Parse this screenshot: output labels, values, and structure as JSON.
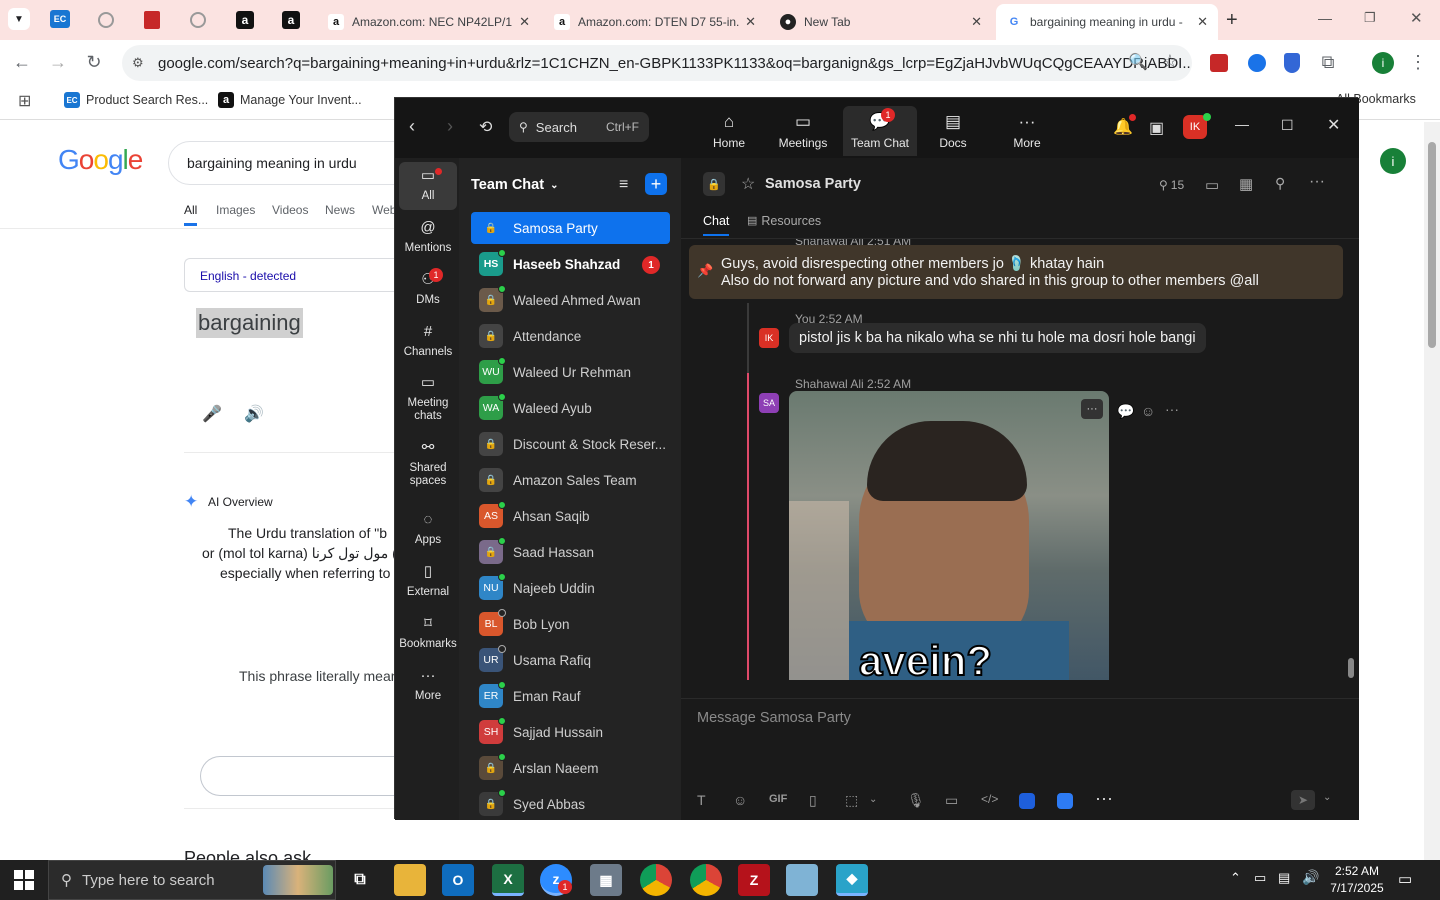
{
  "browser": {
    "tabs": [
      {
        "title": "Amazon.com: NEC NP42LP/1...",
        "icon": "amazon-icon"
      },
      {
        "title": "Amazon.com: DTEN D7 55-in...",
        "icon": "amazon-icon"
      },
      {
        "title": "New Tab",
        "icon": "github-icon"
      },
      {
        "title": "bargaining meaning in urdu -",
        "icon": "google-icon"
      }
    ],
    "url": "google.com/search?q=bargaining+meaning+in+urdu&rlz=1C1CHZN_en-GBPK1133PK1133&oq=barganign&gs_lcrp=EgZjaHJvbWUqCQgCEAAYDRiABDI...",
    "bookmarks": [
      {
        "label": "Product Search Res..."
      },
      {
        "label": "Manage Your Invent..."
      }
    ],
    "all_bookmarks": "All Bookmarks"
  },
  "google": {
    "logo": "Google",
    "query": "bargaining meaning in urdu",
    "nav": [
      "All",
      "Images",
      "Videos",
      "News",
      "Web"
    ],
    "lang_label": "English - detected",
    "source_word": "bargaining",
    "ai_overview": "AI Overview",
    "ai_line1": "The Urdu translation of \"b",
    "ai_line2": "or (mol tol karna) مول تول کرنا (s",
    "ai_line3": "especially when referring to",
    "phrase_line": "This phrase literally means",
    "paa": "People also ask"
  },
  "zoom": {
    "search_label": "Search",
    "search_shortcut": "Ctrl+F",
    "nav": [
      {
        "label": "Home",
        "icon": "home-icon"
      },
      {
        "label": "Meetings",
        "icon": "video-icon"
      },
      {
        "label": "Team Chat",
        "icon": "chat-icon",
        "badge": "1"
      },
      {
        "label": "Docs",
        "icon": "docs-icon"
      },
      {
        "label": "More",
        "icon": "more-icon"
      }
    ],
    "avatar": "IK",
    "rail": [
      {
        "label": "All"
      },
      {
        "label": "Mentions"
      },
      {
        "label": "DMs",
        "badge": "1"
      },
      {
        "label": "Channels"
      },
      {
        "label": "Meeting chats"
      },
      {
        "label": "Shared spaces"
      },
      {
        "label": "Apps"
      },
      {
        "label": "External"
      },
      {
        "label": "Bookmarks"
      },
      {
        "label": "More"
      }
    ],
    "list_header": "Team Chat",
    "chats": [
      {
        "name": "Samosa Party",
        "initials": "",
        "color": "#0e72ed"
      },
      {
        "name": "Haseeb Shahzad",
        "initials": "HS",
        "color": "#1a9c8c",
        "unread": "1"
      },
      {
        "name": "Waleed Ahmed Awan",
        "initials": "",
        "color": "#6b5a4a"
      },
      {
        "name": "Attendance",
        "initials": "",
        "color": "#444444"
      },
      {
        "name": "Waleed Ur Rehman",
        "initials": "WU",
        "color": "#2e9e48"
      },
      {
        "name": "Waleed Ayub",
        "initials": "WA",
        "color": "#2e9e48"
      },
      {
        "name": "Discount & Stock Reser...",
        "initials": "",
        "color": "#444444"
      },
      {
        "name": "Amazon Sales Team",
        "initials": "",
        "color": "#444444"
      },
      {
        "name": "Ahsan Saqib",
        "initials": "AS",
        "color": "#d9572c"
      },
      {
        "name": "Saad Hassan",
        "initials": "",
        "color": "#7a6a8a"
      },
      {
        "name": "Najeeb Uddin",
        "initials": "NU",
        "color": "#2f86c7"
      },
      {
        "name": "Bob Lyon",
        "initials": "BL",
        "color": "#d9572c"
      },
      {
        "name": "Usama Rafiq",
        "initials": "UR",
        "color": "#3a5478"
      },
      {
        "name": "Eman Rauf",
        "initials": "ER",
        "color": "#2f86c7"
      },
      {
        "name": "Sajjad Hussain",
        "initials": "SH",
        "color": "#d03c3c"
      },
      {
        "name": "Arslan Naeem",
        "initials": "",
        "color": "#5a4a3a"
      },
      {
        "name": "Syed Abbas",
        "initials": "",
        "color": "#3a3a3a"
      }
    ],
    "channel": {
      "name": "Samosa Party",
      "members": "15",
      "tabs": [
        "Chat",
        "Resources"
      ]
    },
    "messages": {
      "cut_header": "Shahawal Ali 2:51 AM",
      "pinned_line1": "Guys, avoid disrespecting other members jo 🩴 khatay hain",
      "pinned_line2": "Also do not forward any picture and vdo shared in this group to other members @all",
      "you_header": "You 2:52 AM",
      "you_initials": "IK",
      "you_text": "pistol jis k ba ha nikalo wha se nhi tu hole ma dosri hole bangi",
      "sa_header": "Shahawal Ali 2:52 AM",
      "sa_initials": "SA",
      "image_caption": "avein?"
    },
    "composer_placeholder": "Message Samosa Party",
    "composer_gif": "GIF"
  },
  "taskbar": {
    "search_placeholder": "Type here to search",
    "time": "2:52 AM",
    "date": "7/17/2025"
  }
}
